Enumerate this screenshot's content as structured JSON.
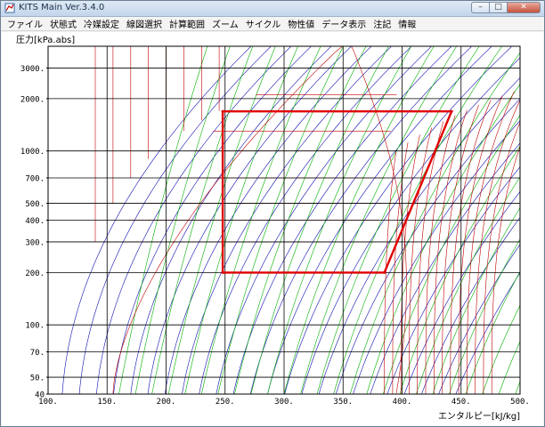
{
  "window": {
    "title": "KITS Main Ver.3.4.0",
    "controls": {
      "minimize": "–",
      "maximize": "□",
      "close": "✕"
    }
  },
  "menu": [
    "ファイル",
    "状態式",
    "冷媒設定",
    "線図選択",
    "計算範囲",
    "ズーム",
    "サイクル",
    "物性値",
    "データ表示",
    "注記",
    "情報"
  ],
  "chart_data": {
    "type": "line",
    "title": "",
    "ylabel": "圧力[kPa.abs]",
    "xlabel": "エンタルピー[kJ/kg]",
    "xlim": [
      100,
      500
    ],
    "ylim": [
      40,
      4000
    ],
    "y_scale": "log",
    "x_ticks": [
      100,
      150,
      200,
      250,
      300,
      350,
      400,
      450,
      500
    ],
    "x_tick_labels": [
      "100.",
      "150.",
      "200.",
      "250.",
      "300.",
      "350.",
      "400.",
      "450.",
      "500."
    ],
    "y_ticks": [
      40,
      50,
      70,
      100,
      200,
      300,
      400,
      500,
      700,
      1000,
      2000,
      3000
    ],
    "y_tick_labels": [
      "40",
      "50.",
      "70.",
      "100.",
      "200.",
      "300.",
      "400.",
      "500.",
      "700.",
      "1000.",
      "2000.",
      "3000."
    ],
    "grid": true,
    "series": [
      {
        "role": "cycle",
        "color": "#e00000",
        "points": [
          [
            248,
            200
          ],
          [
            385,
            200
          ],
          [
            442,
            1690
          ],
          [
            248,
            1690
          ],
          [
            248,
            200
          ]
        ]
      }
    ],
    "colors": {
      "isotherm": "#c00000",
      "isochore": "#1010b0",
      "isentrope": "#00b000",
      "grid": "#000000",
      "cycle": "#e00000"
    }
  }
}
